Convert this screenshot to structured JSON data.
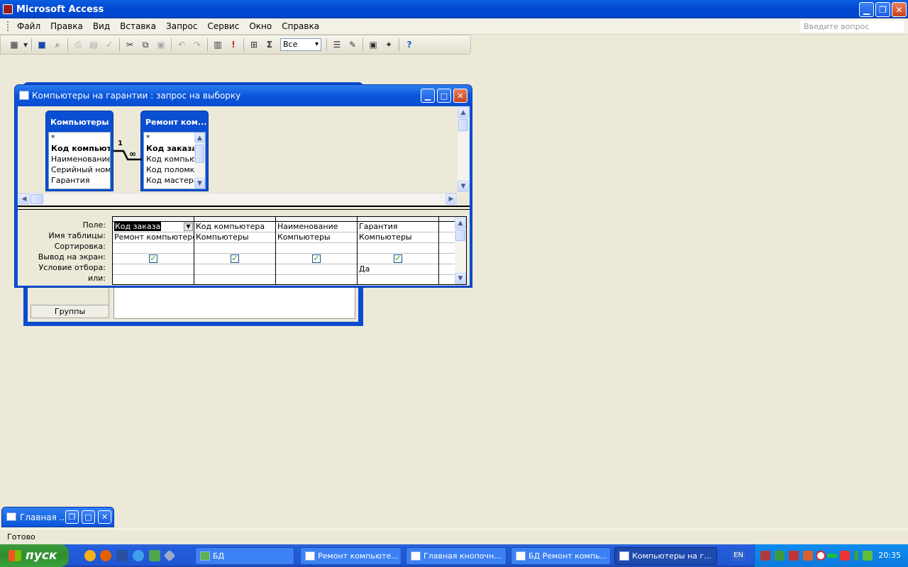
{
  "app": {
    "title": "Microsoft Access"
  },
  "menu": [
    "Файл",
    "Правка",
    "Вид",
    "Вставка",
    "Запрос",
    "Сервис",
    "Окно",
    "Справка"
  ],
  "question_placeholder": "Введите вопрос",
  "toolbar": {
    "select_value": "Все",
    "sigma": "Σ",
    "run": "!"
  },
  "query_window": {
    "title": "Компьютеры на гарантии : запрос на выборку",
    "tables": [
      {
        "name": "Компьютеры",
        "fields": [
          "*",
          "Код компьютера",
          "Наименование",
          "Серийный номер",
          "Гарантия"
        ]
      },
      {
        "name": "Ремонт ком...",
        "fields": [
          "*",
          "Код заказа",
          "Код компьютера",
          "Код поломки",
          "Код мастера"
        ]
      }
    ],
    "relation": {
      "one": "1",
      "many": "∞"
    },
    "row_labels": [
      "Поле:",
      "Имя таблицы:",
      "Сортировка:",
      "Вывод на экран:",
      "Условие отбора:",
      "или:"
    ],
    "columns": [
      {
        "field": "Код заказа",
        "table": "Ремонт компьютеров",
        "show": true,
        "criteria": ""
      },
      {
        "field": "Код компьютера",
        "table": "Компьютеры",
        "show": true,
        "criteria": ""
      },
      {
        "field": "Наименование",
        "table": "Компьютеры",
        "show": true,
        "criteria": ""
      },
      {
        "field": "Гарантия",
        "table": "Компьютеры",
        "show": true,
        "criteria": "Да"
      }
    ]
  },
  "background_form": {
    "groups_label": "Группы"
  },
  "minimized_window": {
    "title": "Главная ..."
  },
  "status": {
    "text": "Готово"
  },
  "taskbar": {
    "start": "пуск",
    "tasks": [
      "БД",
      "Ремонт компьюте...",
      "Главная кнопочн...",
      "БД Ремонт компь...",
      "Компьютеры на г..."
    ],
    "lang": "EN",
    "clock": "20:35"
  }
}
